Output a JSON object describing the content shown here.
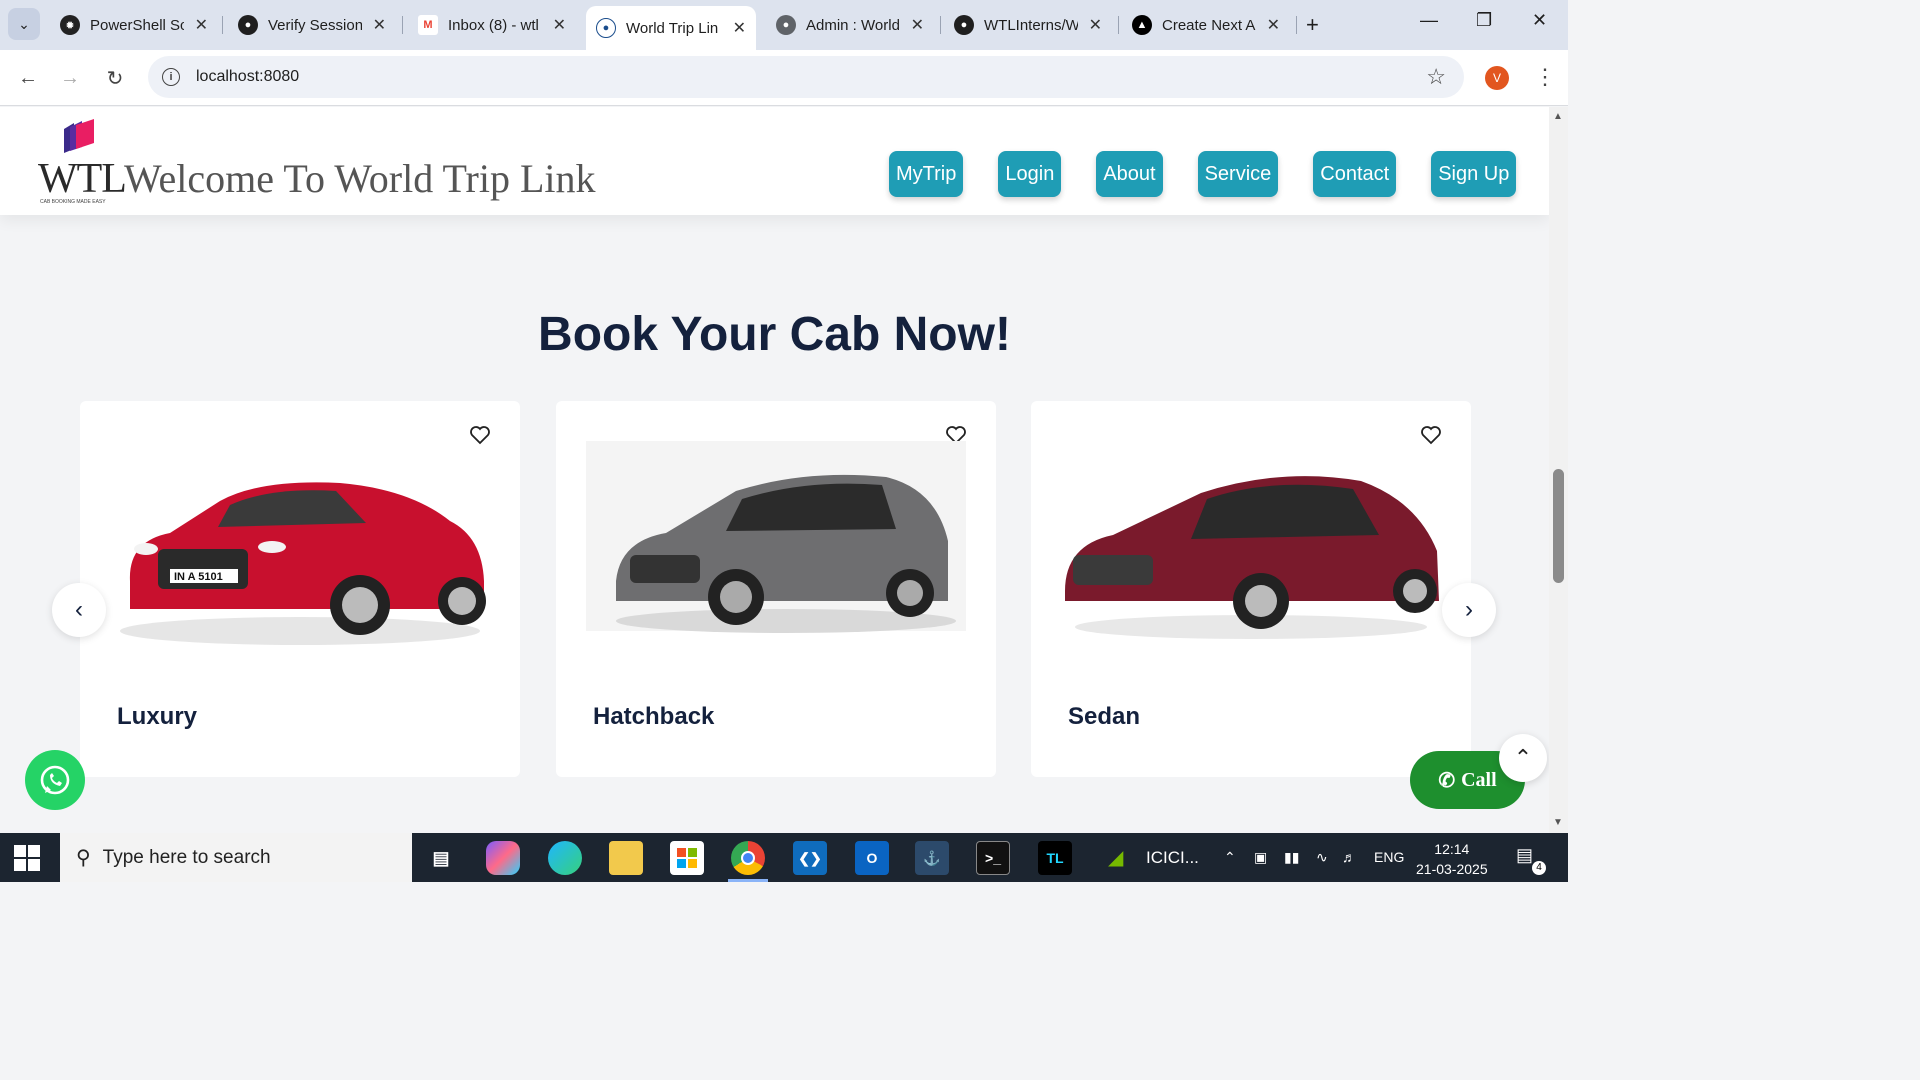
{
  "browser": {
    "tabs": [
      {
        "title": "PowerShell Sc",
        "icon": "openai-icon"
      },
      {
        "title": "Verify Session",
        "icon": "github-icon"
      },
      {
        "title": "Inbox (8) - wtl",
        "icon": "gmail-icon"
      },
      {
        "title": "World Trip Lin",
        "icon": "globe-icon",
        "active": true
      },
      {
        "title": "Admin : World",
        "icon": "globe-icon"
      },
      {
        "title": "WTLInterns/W",
        "icon": "github-icon"
      },
      {
        "title": "Create Next A",
        "icon": "nextjs-icon"
      }
    ],
    "url": "localhost:8080",
    "profile_initial": "V"
  },
  "site": {
    "logo_text": "WTL",
    "logo_tagline": "CAB BOOKING MADE EASY",
    "welcome": "Welcome To World Trip Link",
    "nav": [
      "MyTrip",
      "Login",
      "About",
      "Service",
      "Contact",
      "Sign Up"
    ],
    "heading": "Book Your Cab Now!",
    "cars": [
      {
        "name": "Luxury",
        "color": "#c8102e",
        "plate": "IN A 5101"
      },
      {
        "name": "Hatchback",
        "color": "#6e6e70",
        "plate": ""
      },
      {
        "name": "Sedan",
        "color": "#7a1a2c",
        "plate": ""
      }
    ],
    "call_label": "Call"
  },
  "taskbar": {
    "search_placeholder": "Type here to search",
    "icici_label": "ICICI...",
    "lang": "ENG",
    "time": "12:14",
    "date": "21-03-2025",
    "notif_count": "4"
  },
  "colors": {
    "nav_btn": "#1f9db5",
    "heading": "#14213d",
    "call_btn": "#1e8f2e",
    "whatsapp": "#25d366"
  }
}
